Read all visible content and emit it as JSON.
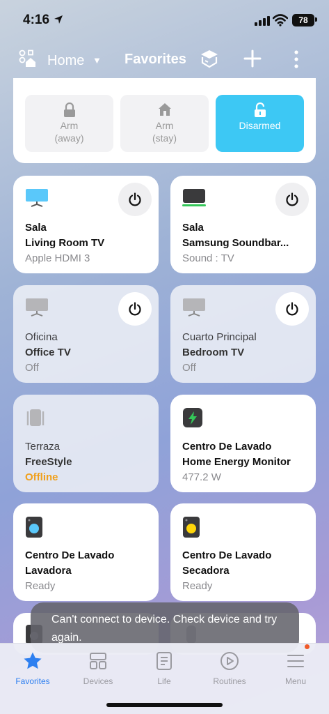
{
  "status_bar": {
    "time": "4:16",
    "battery": "78"
  },
  "header": {
    "home_label": "Home",
    "title": "Favorites"
  },
  "alarm": {
    "buttons": [
      {
        "line1": "Arm",
        "line2": "(away)"
      },
      {
        "line1": "Arm",
        "line2": "(stay)"
      },
      {
        "line1": "Disarmed",
        "line2": ""
      }
    ]
  },
  "devices": [
    {
      "room": "Sala",
      "name": "Living Room TV",
      "status": "Apple HDMI 3"
    },
    {
      "room": "Sala",
      "name": "Samsung Soundbar...",
      "status": "Sound : TV"
    },
    {
      "room": "Oficina",
      "name": "Office TV",
      "status": "Off"
    },
    {
      "room": "Cuarto Principal",
      "name": "Bedroom TV",
      "status": "Off"
    },
    {
      "room": "Terraza",
      "name": "FreeStyle",
      "status": "Offline"
    },
    {
      "room": "Centro De Lavado",
      "name": "Home Energy Monitor",
      "status": "477.2 W"
    },
    {
      "room": "Centro De Lavado",
      "name": "Lavadora",
      "status": "Ready"
    },
    {
      "room": "Centro De Lavado",
      "name": "Secadora",
      "status": "Ready"
    }
  ],
  "toast": {
    "message": "Can't connect to device. Check device and try again."
  },
  "tabs": [
    {
      "label": "Favorites"
    },
    {
      "label": "Devices"
    },
    {
      "label": "Life"
    },
    {
      "label": "Routines"
    },
    {
      "label": "Menu"
    }
  ],
  "colors": {
    "accent": "#2d7ff0",
    "disarmed": "#3dc8f4",
    "offline": "#f0a01c",
    "tv_on": "#5ac8fa",
    "washer": "#5ac8fa",
    "dryer": "#ffd60a",
    "energy": "#34c759"
  }
}
